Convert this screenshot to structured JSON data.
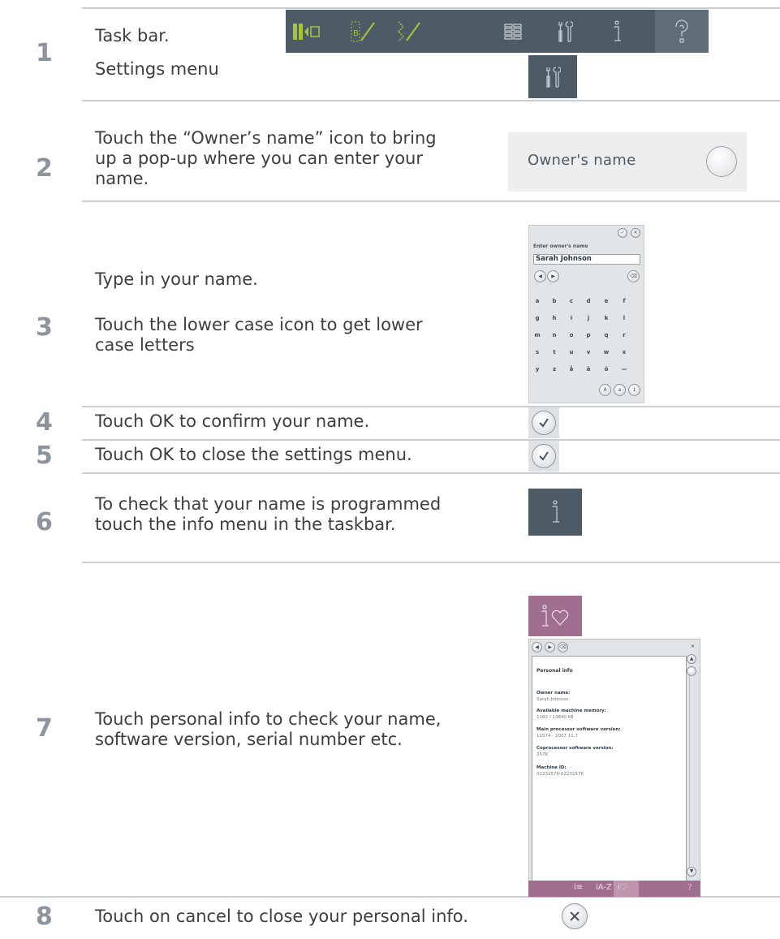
{
  "steps": [
    {
      "number": "1",
      "lines": [
        "Task bar.",
        "Settings menu"
      ]
    },
    {
      "number": "2",
      "text": "Touch the “Owner’s name” icon to bring up a pop-up where you can enter your name."
    },
    {
      "number": "3",
      "text_a": "Type in your name.",
      "text_b": "Touch the lower case icon to get lower case letters"
    },
    {
      "number": "4",
      "text": "Touch OK to confirm your name."
    },
    {
      "number": "5",
      "text": "Touch OK to close the settings menu."
    },
    {
      "number": "6",
      "text": "To check that your name is programmed touch the info menu in the taskbar."
    },
    {
      "number": "7",
      "text": "Touch personal info to check your name, software version, serial number etc."
    },
    {
      "number": "8",
      "text": "Touch on cancel to close your personal info."
    }
  ],
  "owner_name_widget": {
    "label": "Owner's name"
  },
  "keyboard_popup": {
    "title": "Enter owner's name",
    "value": "Sarah Johnson",
    "rows": [
      [
        "a",
        "b",
        "c",
        "d",
        "e",
        "f"
      ],
      [
        "g",
        "h",
        "i",
        "j",
        "k",
        "l"
      ],
      [
        "m",
        "n",
        "o",
        "p",
        "q",
        "r"
      ],
      [
        "s",
        "t",
        "u",
        "v",
        "w",
        "x"
      ],
      [
        "y",
        "z",
        "å",
        "ä",
        "ö",
        "—"
      ]
    ],
    "mode_buttons": [
      "A",
      "a",
      "1"
    ]
  },
  "personal_info": {
    "heading": "Personal info",
    "fields": [
      {
        "label": "Owner name:",
        "value": "Sarah Johnson"
      },
      {
        "label": "Available machine memory:",
        "value": "1182 / 13840 kB"
      },
      {
        "label": "Main processor software version:",
        "value": "11574 - 2007.11.7"
      },
      {
        "label": "Coprocessor software version:",
        "value": "2576"
      },
      {
        "label": "Machine ID:",
        "value": "02232576-02232576"
      }
    ]
  },
  "colors": {
    "taskbar": "#4d5b67",
    "personal_info_accent": "#a06e8f",
    "taskbar_icon_active": "#a8c43a"
  }
}
